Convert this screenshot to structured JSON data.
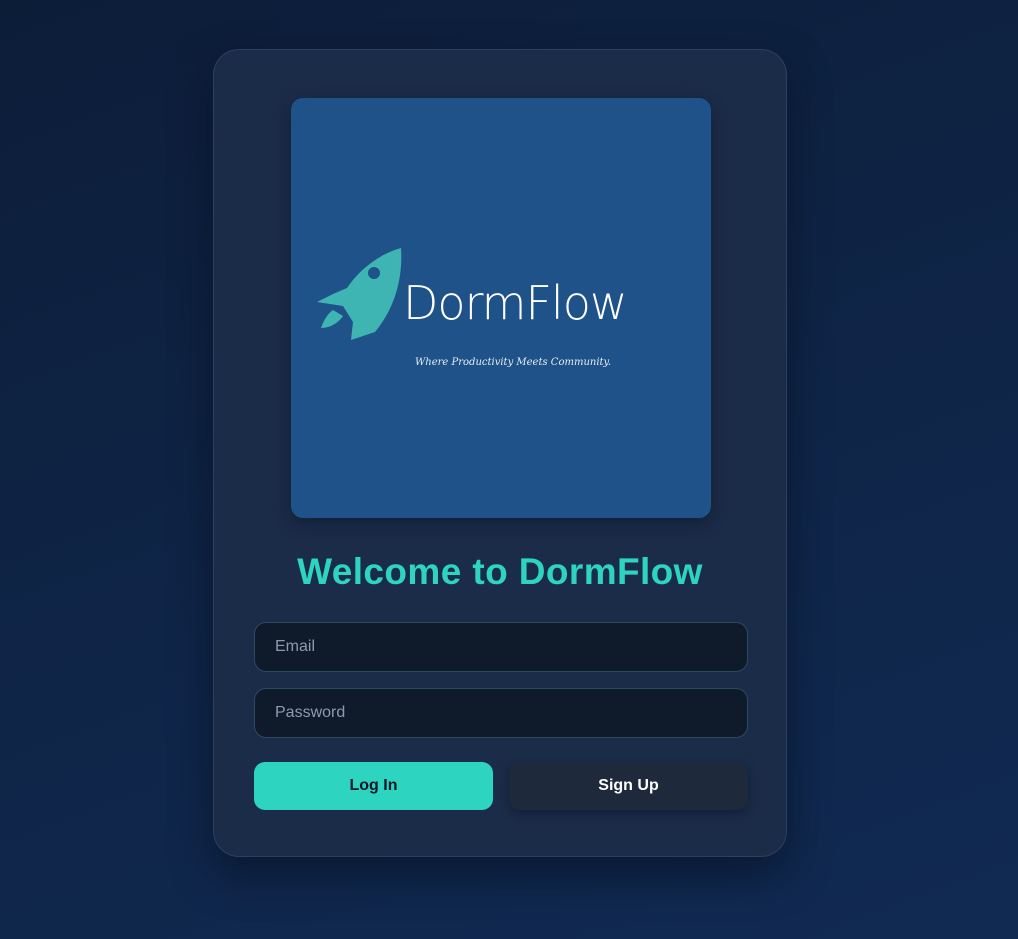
{
  "logo": {
    "brand_name": "DormFlow",
    "tagline": "Where Productivity Meets Community.",
    "icon": "rocket-icon"
  },
  "heading": "Welcome to DormFlow",
  "form": {
    "email_placeholder": "Email",
    "email_value": "",
    "password_placeholder": "Password",
    "password_value": ""
  },
  "buttons": {
    "login_label": "Log In",
    "signup_label": "Sign Up"
  },
  "colors": {
    "accent": "#2dd4bf",
    "logo_background": "#1f5289",
    "rocket": "#3fb5b3",
    "card": "#1b2c48",
    "page_background": "#0f2548"
  }
}
